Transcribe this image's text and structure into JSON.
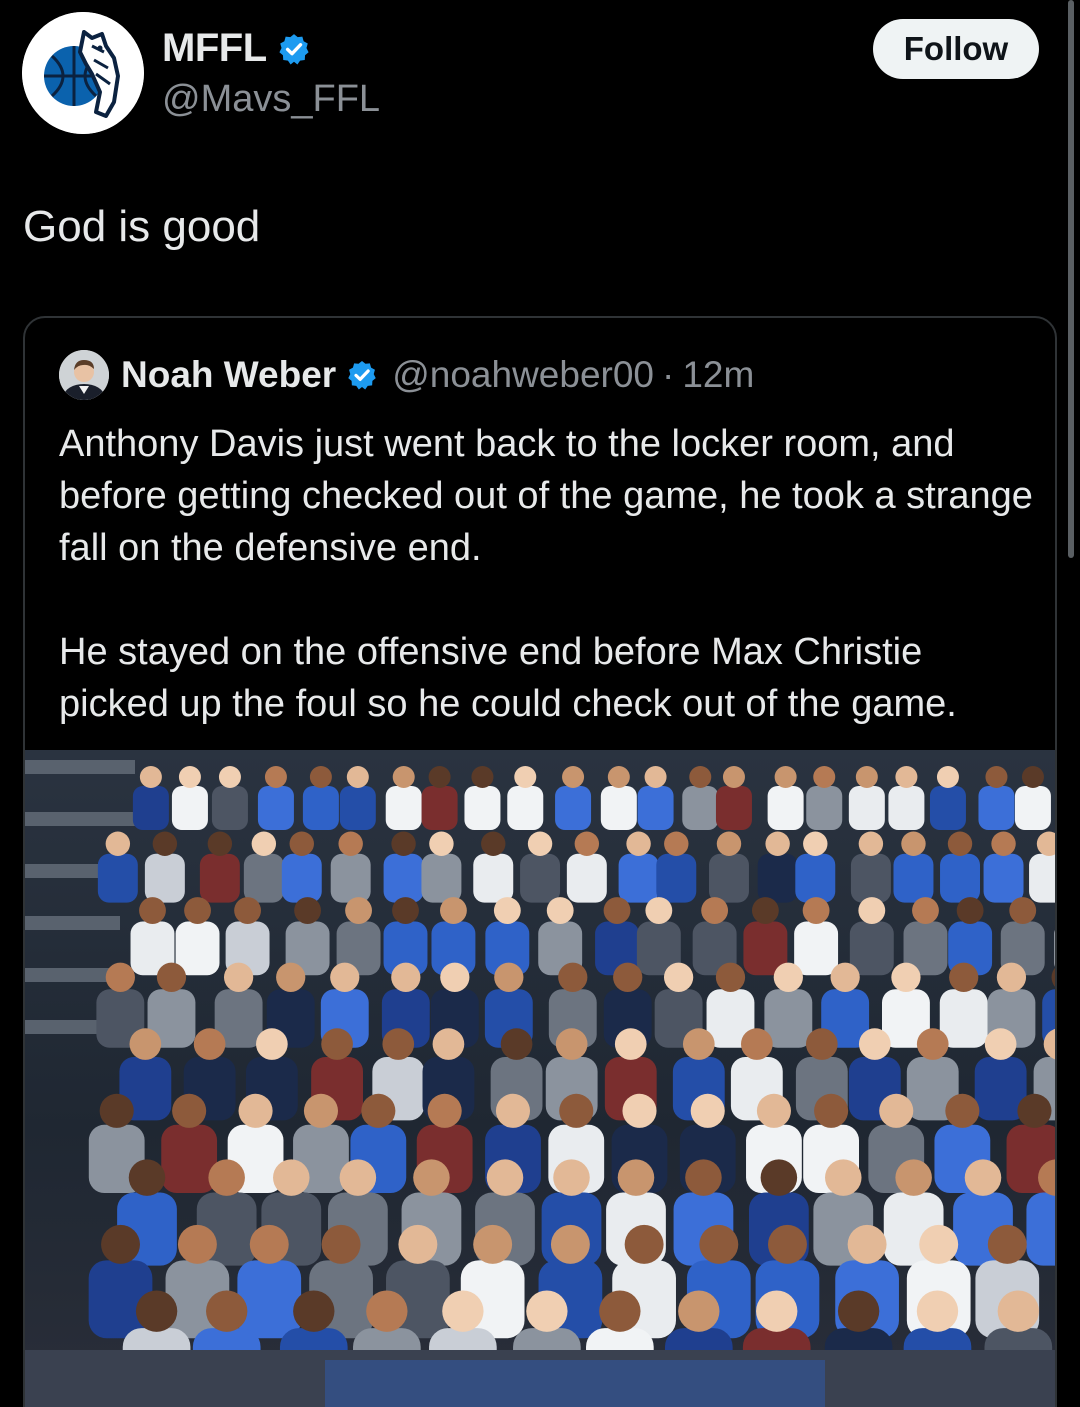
{
  "tweet": {
    "author": {
      "display_name": "MFFL",
      "handle": "@Mavs_FFL",
      "verified": true,
      "avatar_icon": "mavericks-logo-icon"
    },
    "follow_label": "Follow",
    "text": "God is good"
  },
  "quote": {
    "author": {
      "display_name": "Noah Weber",
      "handle": "@noahweber00",
      "separator": "·",
      "time": "12m",
      "verified": true
    },
    "paragraphs": [
      "Anthony Davis just went back to the locker room, and before getting checked out of the game, he took a strange fall on the defensive end.",
      "He stayed on the offensive end before Max Christie picked up the foul so he could check out of the game."
    ],
    "media": {
      "type": "photo",
      "icon": "arena-crowd-photo"
    }
  },
  "colors": {
    "background": "#000000",
    "text_primary": "#e7e9ea",
    "text_secondary": "#8b9096",
    "verified_blue": "#1d9bf0",
    "follow_bg": "#eff3f4",
    "card_border": "#2f3336"
  }
}
